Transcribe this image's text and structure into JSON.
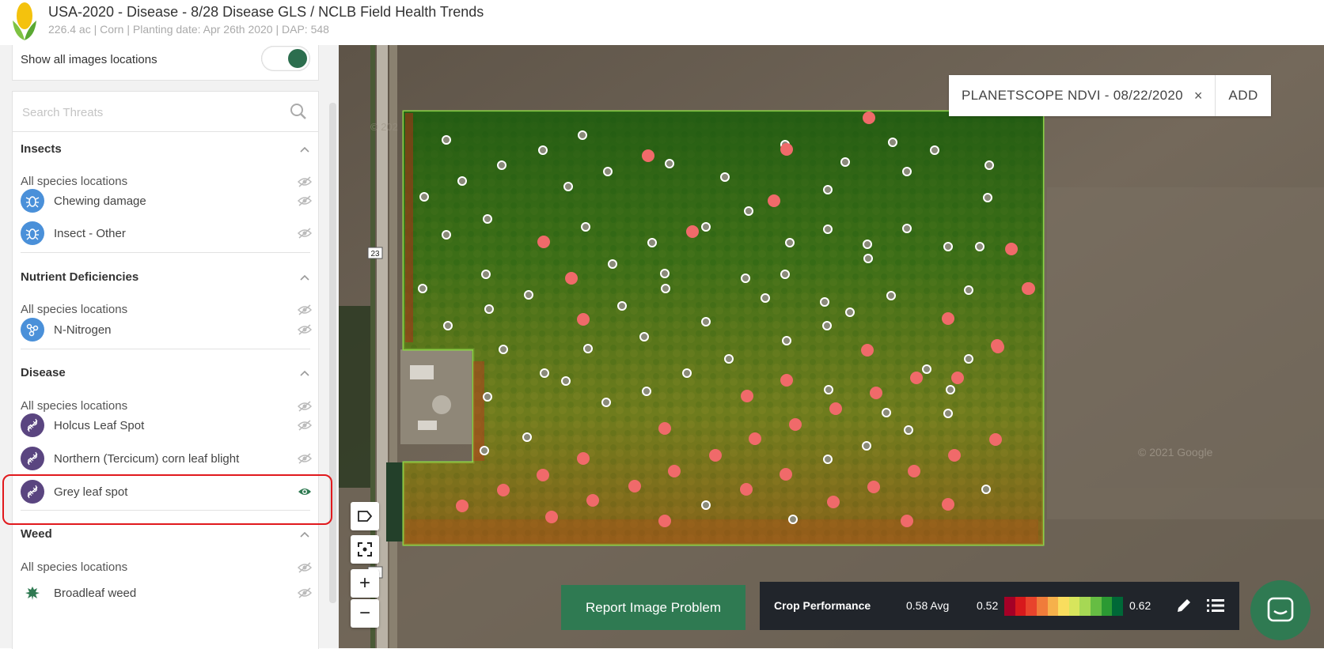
{
  "header": {
    "title": "USA-2020 - Disease - 8/28 Disease GLS / NCLB Field Health Trends",
    "subtitle": "226.4 ac | Corn | Planting date: Apr 26th 2020 | DAP: 548"
  },
  "sidebar": {
    "toggle_label": "Show all images locations",
    "toggle_on": true,
    "search_placeholder": "Search Threats",
    "sections": {
      "insects": {
        "title": "Insects",
        "all_locations": "All species locations",
        "items": [
          "Chewing damage",
          "Insect - Other"
        ]
      },
      "nutrient": {
        "title": "Nutrient Deficiencies",
        "all_locations": "All species locations",
        "items": [
          "N-Nitrogen"
        ]
      },
      "disease": {
        "title": "Disease",
        "all_locations": "All species locations",
        "items": [
          "Holcus Leaf Spot",
          "Northern (Tercicum) corn leaf blight",
          "Grey leaf spot"
        ]
      },
      "weed": {
        "title": "Weed",
        "all_locations": "All species locations",
        "items": [
          "Broadleaf weed"
        ]
      }
    }
  },
  "map": {
    "layer_label": "PLANETSCOPE NDVI - 08/22/2020",
    "close_symbol": "×",
    "add_label": "ADD",
    "road_label_top": "23",
    "road_label_bottom": "23",
    "copyright": "© 2021 Google",
    "copyright_left": "© 202",
    "zoom_in": "+",
    "zoom_out": "−"
  },
  "footer": {
    "report_button": "Report Image Problem",
    "legend_title": "Crop Performance",
    "legend_avg": "0.58 Avg",
    "legend_min": "0.52",
    "legend_max": "0.62",
    "legend_colors": [
      "#a50026",
      "#d7191c",
      "#e8432c",
      "#f07c3a",
      "#f6b14b",
      "#f9dd5e",
      "#d7e55c",
      "#a6d854",
      "#66bd43",
      "#2b9a33",
      "#006837"
    ]
  },
  "colors": {
    "accent": "#2f7a52",
    "insect_badge": "#4a90d9",
    "disease_badge": "#5a4580",
    "highlight": "#e1191d",
    "field_border": "#8bd146",
    "disease_marker": "#f06a6a"
  }
}
